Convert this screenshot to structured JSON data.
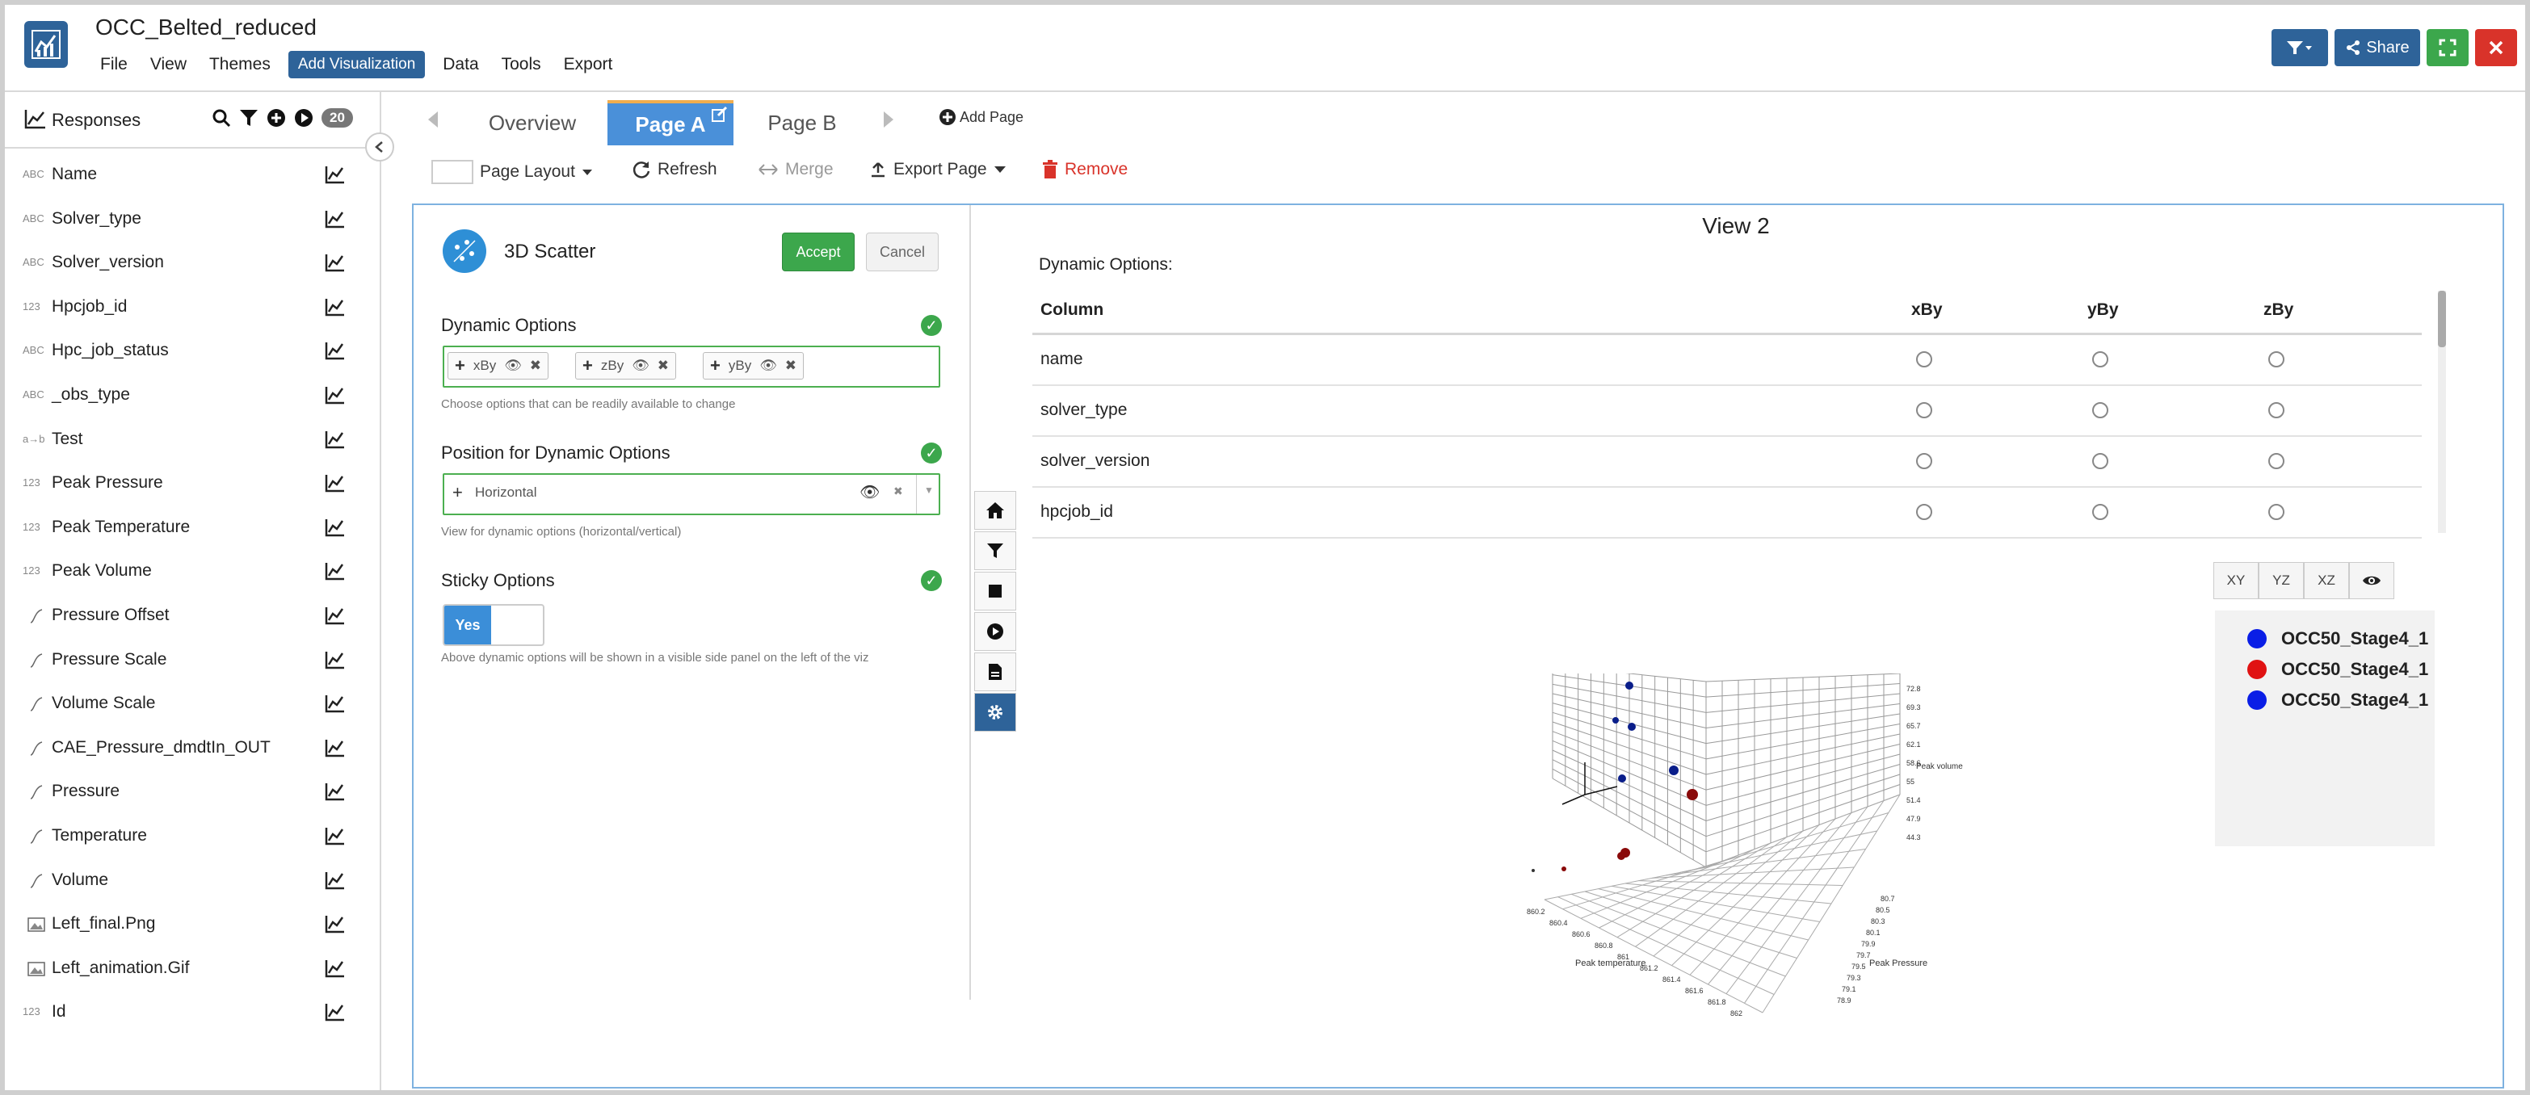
{
  "app": {
    "title": "OCC_Belted_reduced",
    "menu": [
      "File",
      "View",
      "Themes",
      "Add Visualization",
      "Data",
      "Tools",
      "Export"
    ],
    "share_label": "Share"
  },
  "sidebar": {
    "title": "Responses",
    "count": "20",
    "items": [
      {
        "type": "ABC",
        "label": "Name"
      },
      {
        "type": "ABC",
        "label": "Solver_type"
      },
      {
        "type": "ABC",
        "label": "Solver_version"
      },
      {
        "type": "123",
        "label": "Hpcjob_id"
      },
      {
        "type": "ABC",
        "label": "Hpc_job_status"
      },
      {
        "type": "ABC",
        "label": "_obs_type"
      },
      {
        "type": "a→b",
        "label": "Test"
      },
      {
        "type": "123",
        "label": "Peak Pressure"
      },
      {
        "type": "123",
        "label": "Peak Temperature"
      },
      {
        "type": "123",
        "label": "Peak Volume"
      },
      {
        "type": "curve",
        "label": "Pressure Offset"
      },
      {
        "type": "curve",
        "label": "Pressure Scale"
      },
      {
        "type": "curve",
        "label": "Volume Scale"
      },
      {
        "type": "curve",
        "label": "CAE_Pressure_dmdtIn_OUT"
      },
      {
        "type": "curve",
        "label": "Pressure"
      },
      {
        "type": "curve",
        "label": "Temperature"
      },
      {
        "type": "curve",
        "label": "Volume"
      },
      {
        "type": "image",
        "label": "Left_final.Png"
      },
      {
        "type": "image",
        "label": "Left_animation.Gif"
      },
      {
        "type": "123",
        "label": "Id"
      }
    ]
  },
  "tabs": {
    "items": [
      "Overview",
      "Page A",
      "Page B"
    ],
    "active": "Page A",
    "add_label": "Add Page"
  },
  "toolbar": {
    "page_layout": "Page Layout",
    "refresh": "Refresh",
    "merge": "Merge",
    "export_page": "Export Page",
    "remove": "Remove"
  },
  "editor": {
    "viz_name": "3D Scatter",
    "accept": "Accept",
    "cancel": "Cancel",
    "dynamic_options_title": "Dynamic Options",
    "dynamic_chips": [
      "xBy",
      "zBy",
      "yBy"
    ],
    "dynamic_hint": "Choose options that can be readily available to change",
    "position_title": "Position for Dynamic Options",
    "position_value": "Horizontal",
    "position_hint": "View for dynamic options (horizontal/vertical)",
    "sticky_title": "Sticky Options",
    "sticky_toggle": "Yes",
    "sticky_hint": "Above dynamic options will be shown in a visible side panel on the left of the viz"
  },
  "view": {
    "title": "View 2",
    "dynamic_label": "Dynamic Options:",
    "columns": [
      "Column",
      "xBy",
      "yBy",
      "zBy"
    ],
    "rows": [
      "name",
      "solver_type",
      "solver_version",
      "hpcjob_id"
    ],
    "axis_buttons": [
      "XY",
      "YZ",
      "XZ"
    ],
    "legend": [
      {
        "label": "OCC50_Stage4_1",
        "color": "#0a1ee6"
      },
      {
        "label": "OCC50_Stage4_1",
        "color": "#e01212"
      },
      {
        "label": "OCC50_Stage4_1",
        "color": "#0a1ee6"
      }
    ]
  },
  "plot3d": {
    "x_label": "Peak temperature",
    "y_label": "Peak Pressure",
    "z_label": "Peak volume",
    "x_ticks": [
      "860.2",
      "860.4",
      "860.6",
      "860.8",
      "861",
      "861.2",
      "861.4",
      "861.6",
      "861.8",
      "862"
    ],
    "y_ticks": [
      "80.7",
      "80.5",
      "80.3",
      "80.1",
      "79.9",
      "79.7",
      "79.5",
      "79.3",
      "79.1",
      "78.9"
    ],
    "z_ticks": [
      "72.8",
      "69.3",
      "65.7",
      "62.1",
      "58.6",
      "55",
      "51.4",
      "47.9",
      "44.3"
    ]
  }
}
